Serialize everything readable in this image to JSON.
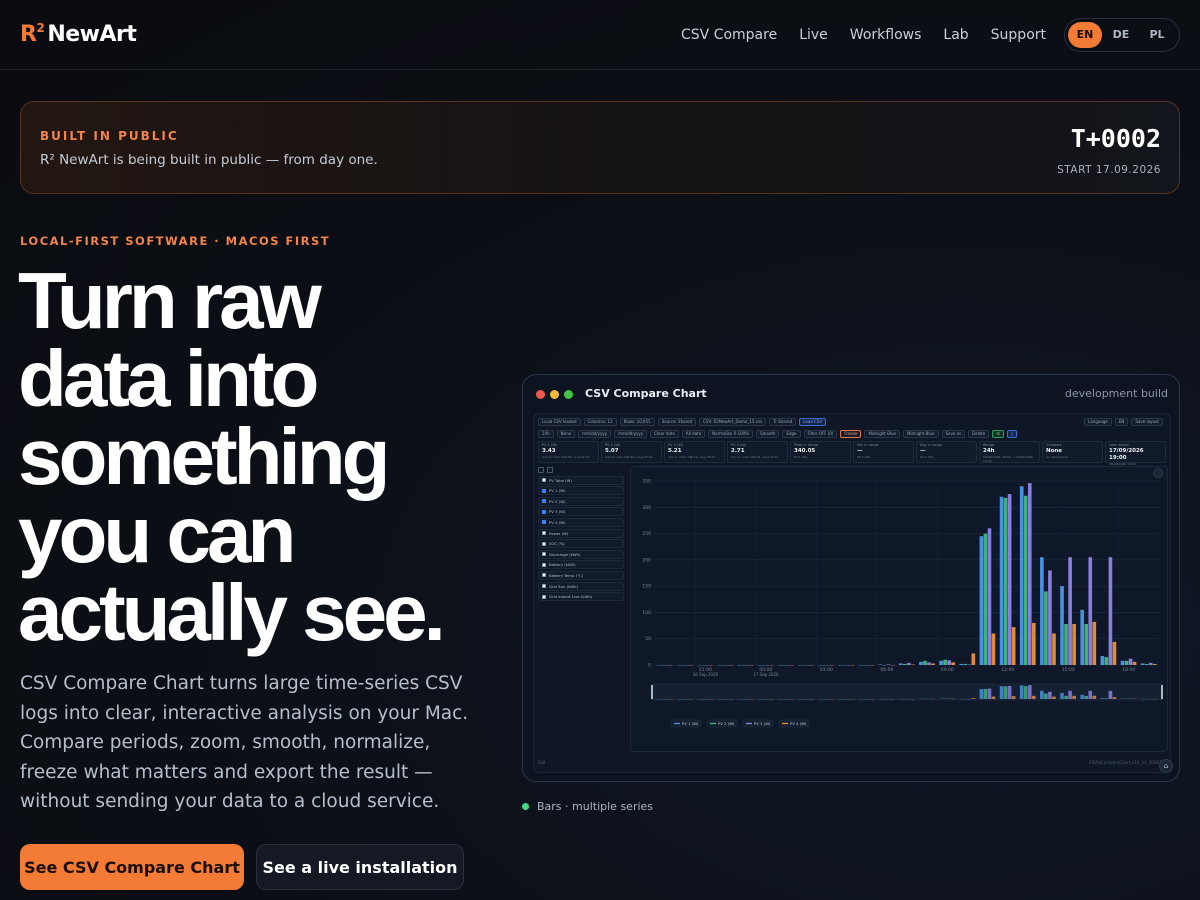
{
  "brand": {
    "mark": "R",
    "sup": "2",
    "name": "NewArt"
  },
  "nav": {
    "links": [
      "CSV Compare",
      "Live",
      "Workflows",
      "Lab",
      "Support"
    ],
    "languages": [
      "EN",
      "DE",
      "PL"
    ],
    "active_language": "EN"
  },
  "banner": {
    "kicker": "BUILT IN PUBLIC",
    "text": "R² NewArt is being built in public — from day one.",
    "counter": "T+0002",
    "start": "START 17.09.2026"
  },
  "hero": {
    "eyebrow": "LOCAL-FIRST SOFTWARE · MACOS FIRST",
    "headline_lines": [
      "Turn raw",
      "data into",
      "something",
      "you can",
      "actually see."
    ],
    "lede": "CSV Compare Chart turns large time-series CSV logs into clear, interactive analysis on your Mac. Compare periods, zoom, smooth, normalize, freeze what matters and export the result — without sending your data to a cloud service.",
    "cta_primary": "See CSV Compare Chart",
    "cta_secondary": "See a live installation"
  },
  "preview": {
    "window_title": "CSV Compare Chart",
    "build_label": "development build",
    "caption": "Bars · multiple series",
    "toolbar1": [
      "Local CSV loaded",
      "Columns: 12",
      "Rows: 10,955",
      "Source: Shared",
      "CSV: R2NewArt_Demo_15.csv",
      "Tr Shared",
      "Load CSV"
    ],
    "toolbar1_right": [
      "Language",
      "EN",
      "Save layout"
    ],
    "toolbar2": [
      "24h",
      "None",
      "mm/dd/yyyy",
      "mm/dd/yyyy",
      "Clear date",
      "All data",
      "Normalize 0-100%",
      "Smooth",
      "Edge",
      "Filter OFF (0)",
      "Freeze",
      "Midnight Blue",
      "Midnight Blue",
      "Save as",
      "Delete"
    ],
    "stats": [
      {
        "k": "PV 1 (W)",
        "v": "3.43",
        "s": "min 0 / max 340.05 / avg 52.33"
      },
      {
        "k": "PV 2 (W)",
        "v": "5.07",
        "s": "min 0 / max 332.89 / avg 25.42"
      },
      {
        "k": "PV 3 (W)",
        "v": "5.21",
        "s": "min 0 / max 346.21 / avg 38.07"
      },
      {
        "k": "PV 4 (W)",
        "v": "2.71",
        "s": "min 0 / max 208.45 / avg 22.15"
      },
      {
        "k": "Peak in range",
        "v": "340.05",
        "s": "PV 1 (W)"
      },
      {
        "k": "Min in range",
        "v": "—",
        "s": "PV 1 (W)"
      },
      {
        "k": "Avg in range",
        "v": "—",
        "s": "PV 1 (W)"
      },
      {
        "k": "Range",
        "v": "24h",
        "s": "16/09/2026, 19:00 → 17/09/2026, 19:00"
      },
      {
        "k": "Compare",
        "v": "None",
        "s": "no comparison"
      },
      {
        "k": "Last record",
        "v": "17/09/2026 19:00",
        "s": "30/09/2026 19:00"
      }
    ],
    "series": [
      {
        "label": "PV Total (W)",
        "checked": false
      },
      {
        "label": "PV 1 (W)",
        "checked": true
      },
      {
        "label": "PV 2 (W)",
        "checked": true
      },
      {
        "label": "PV 3 (W)",
        "checked": true
      },
      {
        "label": "PV 4 (W)",
        "checked": true
      },
      {
        "label": "Power (W)",
        "checked": false
      },
      {
        "label": "SOC (%)",
        "checked": false
      },
      {
        "label": "Discharge (kWh)",
        "checked": false
      },
      {
        "label": "Battery (kWh)",
        "checked": false
      },
      {
        "label": "Battery Temp (°C)",
        "checked": false
      },
      {
        "label": "Grid Sun (kWh)",
        "checked": false
      },
      {
        "label": "Grid Import Live (kWh)",
        "checked": false
      }
    ],
    "status_left": "Full",
    "status_right": "CSVtoCompareChart_v14_11_300826"
  },
  "chart_data": {
    "type": "bar",
    "categories": [
      "19:00",
      "20:00",
      "21:00",
      "22:00",
      "23:00",
      "00:00",
      "01:00",
      "02:00",
      "03:00",
      "04:00",
      "05:00",
      "06:00",
      "07:00",
      "08:00",
      "09:00",
      "10:00",
      "11:00",
      "12:00",
      "13:00",
      "14:00",
      "15:00",
      "16:00",
      "17:00",
      "18:00",
      "19:00"
    ],
    "x_tick_labels": [
      "21:00",
      "00:00",
      "03:00",
      "06:00",
      "09:00",
      "12:00",
      "15:00",
      "18:00"
    ],
    "x_date_labels": [
      "16 Sep 2026",
      "17 Sep 2026"
    ],
    "series": [
      {
        "name": "PV 1 (W)",
        "values": [
          0,
          0,
          0,
          0,
          0,
          0,
          0,
          0,
          0,
          0,
          0,
          1,
          3,
          6,
          8,
          2,
          245,
          320,
          340,
          205,
          150,
          105,
          17,
          8,
          3
        ]
      },
      {
        "name": "PV 2 (W)",
        "values": [
          0,
          0,
          0,
          0,
          0,
          0,
          0,
          0,
          0,
          0,
          0,
          0,
          2,
          8,
          10,
          2,
          250,
          318,
          322,
          140,
          78,
          78,
          15,
          8,
          2
        ]
      },
      {
        "name": "PV 3 (W)",
        "values": [
          0,
          0,
          0,
          0,
          0,
          0,
          0,
          0,
          0,
          0,
          0,
          1,
          4,
          5,
          9,
          1,
          260,
          325,
          346,
          180,
          205,
          205,
          205,
          12,
          4
        ]
      },
      {
        "name": "PV 4 (W)",
        "values": [
          0,
          0,
          0,
          0,
          0,
          0,
          0,
          0,
          0,
          0,
          0,
          0,
          1,
          3,
          5,
          22,
          60,
          72,
          80,
          60,
          78,
          82,
          44,
          6,
          2
        ]
      }
    ],
    "colors": [
      "#4a90e2",
      "#3fb27a",
      "#8a7fe0",
      "#e08a3a"
    ],
    "ylim": [
      0,
      350
    ],
    "yticks": [
      0,
      50,
      100,
      150,
      200,
      250,
      300,
      350
    ],
    "legend": "bottom-left",
    "grid": true
  }
}
